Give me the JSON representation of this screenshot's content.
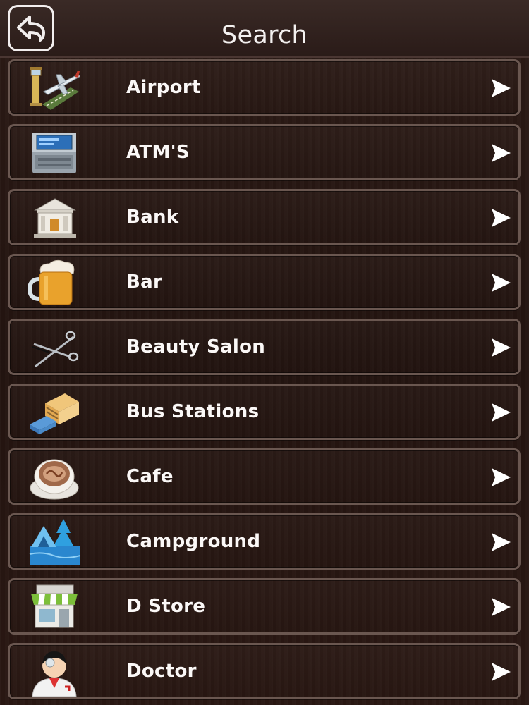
{
  "header": {
    "title": "Search",
    "back_icon": "back-arrow-icon"
  },
  "colors": {
    "background": "#24140f",
    "header": "#2f201d",
    "row_border": "#6a5750",
    "text": "#fbf8f7"
  },
  "categories": [
    {
      "label": "Airport",
      "icon": "airport-icon"
    },
    {
      "label": "ATM'S",
      "icon": "atm-icon"
    },
    {
      "label": "Bank",
      "icon": "bank-icon"
    },
    {
      "label": "Bar",
      "icon": "beer-mug-icon"
    },
    {
      "label": "Beauty Salon",
      "icon": "scissors-icon"
    },
    {
      "label": "Bus Stations",
      "icon": "bus-station-icon"
    },
    {
      "label": "Cafe",
      "icon": "coffee-cup-icon"
    },
    {
      "label": "Campground",
      "icon": "campground-icon"
    },
    {
      "label": "D Store",
      "icon": "store-icon"
    },
    {
      "label": "Doctor",
      "icon": "doctor-icon"
    }
  ]
}
